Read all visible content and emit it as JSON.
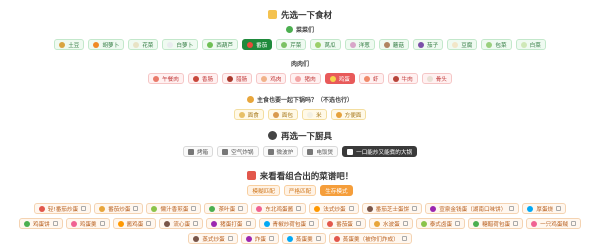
{
  "headings": {
    "pick_ingredients": "先选一下食材",
    "vegetables": "菜菜们",
    "meat": "肉肉们",
    "staple": "主食也要一起下锅吗？（不选也行）",
    "pick_tools": "再选一下厨具",
    "recipes": "来看看组合出的菜谱吧！"
  },
  "vegetables": [
    {
      "label": "土豆",
      "color": "#d9a441",
      "active": false
    },
    {
      "label": "胡萝卜",
      "color": "#f08a24",
      "active": false
    },
    {
      "label": "花菜",
      "color": "#e8e3c6",
      "active": false
    },
    {
      "label": "白萝卜",
      "color": "#e9ecef",
      "active": false
    },
    {
      "label": "西葫芦",
      "color": "#6fbf55",
      "active": false
    },
    {
      "label": "番茄",
      "color": "#e84a3a",
      "active": true
    },
    {
      "label": "芹菜",
      "color": "#7cc265",
      "active": false
    },
    {
      "label": "莴瓜",
      "color": "#9bcf6a",
      "active": false
    },
    {
      "label": "洋葱",
      "color": "#d8a6c9",
      "active": false
    },
    {
      "label": "蘑菇",
      "color": "#b08461",
      "active": false
    },
    {
      "label": "茄子",
      "color": "#7b4fa8",
      "active": false
    },
    {
      "label": "豆腐",
      "color": "#f2e6c8",
      "active": false
    },
    {
      "label": "包菜",
      "color": "#9ad07e",
      "active": false
    },
    {
      "label": "白菜",
      "color": "#cfe8b8",
      "active": false
    }
  ],
  "meat": [
    {
      "label": "午餐肉",
      "color": "#e97a6a",
      "active": false
    },
    {
      "label": "香肠",
      "color": "#c8473b",
      "active": false
    },
    {
      "label": "腊肠",
      "color": "#a93a2e",
      "active": false
    },
    {
      "label": "鸡肉",
      "color": "#f1b38a",
      "active": false
    },
    {
      "label": "猪肉",
      "color": "#f3a5a5",
      "active": false
    },
    {
      "label": "鸡蛋",
      "color": "#f6d24a",
      "active": true
    },
    {
      "label": "虾",
      "color": "#f08a6a",
      "active": false
    },
    {
      "label": "牛肉",
      "color": "#b8443a",
      "active": false
    },
    {
      "label": "骨头",
      "color": "#e9e1d6",
      "active": false
    }
  ],
  "staple": [
    {
      "label": "面食",
      "color": "#e7c067"
    },
    {
      "label": "面包",
      "color": "#d99a4e"
    },
    {
      "label": "米",
      "color": "#f3f0e4"
    },
    {
      "label": "方便面",
      "color": "#e6a23c"
    }
  ],
  "tools": [
    {
      "label": "烤箱",
      "active": false
    },
    {
      "label": "空气炸锅",
      "active": false
    },
    {
      "label": "微波炉",
      "active": false
    },
    {
      "label": "电饭煲",
      "active": false
    },
    {
      "label": "一口能炒又能煮的大锅",
      "active": true
    }
  ],
  "modes": [
    {
      "label": "模糊匹配",
      "active": false
    },
    {
      "label": "严格匹配",
      "active": false
    },
    {
      "label": "生存模式",
      "active": true
    }
  ],
  "recipes_rows": [
    [
      "轻!番茄炒蛋",
      "番茄炒蛋",
      "懒汁香煎蛋",
      "茶叶蛋",
      "东北鸡蛋酱",
      "法式炒蛋",
      "番茄芝士蛋饼",
      "宣泉金钱蛋（湖南口味饼）",
      "厚蛋烧"
    ],
    [
      "鸡蛋饼",
      "鸡蛋羹",
      "酱鸡蛋",
      "流心蛋",
      "猪蛋打蛋",
      "青椒炒荷包蛋",
      "番茄蛋",
      "水波蛋",
      "泰式卤蛋",
      "糖醋荷包蛋",
      "一只鸡蛋贼"
    ],
    [
      "蒸式炒蛋",
      "炸蛋",
      "蒸蛋羹",
      "蒸蛋羹（被你们炸成）"
    ]
  ],
  "colors": {
    "veg_active": "#1f8a3c",
    "meat_active": "#e85a5a",
    "tool_active": "#3a3a3a",
    "mode_active": "#f59e3b"
  }
}
